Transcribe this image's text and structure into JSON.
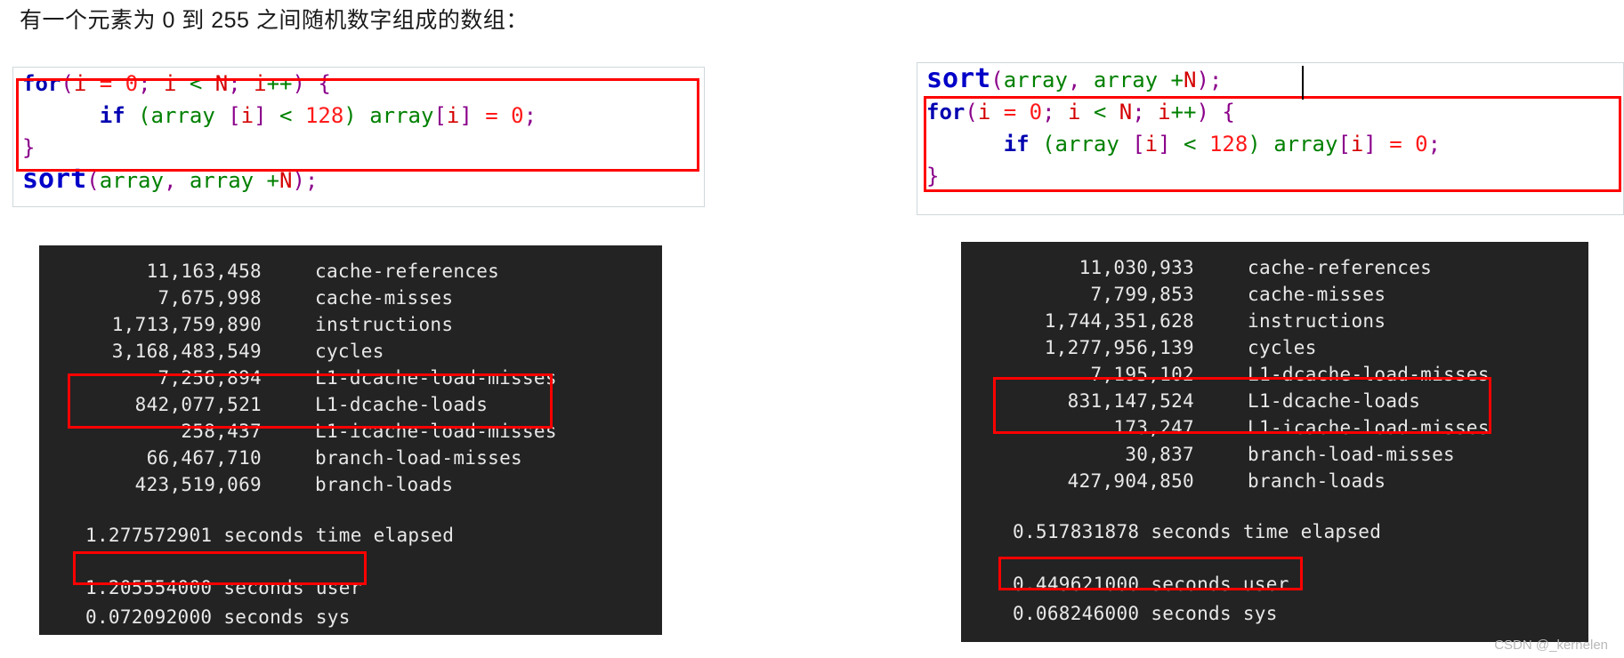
{
  "heading": "有一个元素为 0 到 255 之间随机数字组成的数组：",
  "code_left": {
    "lines": [
      {
        "tokens": [
          {
            "t": "for",
            "c": "kw"
          },
          {
            "t": "(",
            "c": "punct"
          },
          {
            "t": "i",
            "c": "ident"
          },
          {
            "t": " = ",
            "c": "num"
          },
          {
            "t": "0",
            "c": "num"
          },
          {
            "t": "; ",
            "c": "punct"
          },
          {
            "t": "i",
            "c": "ident"
          },
          {
            "t": " < ",
            "c": "op"
          },
          {
            "t": "N",
            "c": "ident"
          },
          {
            "t": "; ",
            "c": "punct"
          },
          {
            "t": "i",
            "c": "ident"
          },
          {
            "t": "++",
            "c": "op"
          },
          {
            "t": ")",
            "c": "punct"
          },
          {
            "t": " ",
            "c": "plain"
          },
          {
            "t": "{",
            "c": "brk"
          }
        ]
      },
      {
        "tokens": [
          {
            "t": "      ",
            "c": "plain"
          },
          {
            "t": "if",
            "c": "kw-if"
          },
          {
            "t": " ",
            "c": "plain"
          },
          {
            "t": "(",
            "c": "op"
          },
          {
            "t": "array",
            "c": "green"
          },
          {
            "t": " ",
            "c": "plain"
          },
          {
            "t": "[",
            "c": "brk"
          },
          {
            "t": "i",
            "c": "ident"
          },
          {
            "t": "]",
            "c": "brk"
          },
          {
            "t": " < ",
            "c": "op"
          },
          {
            "t": "128",
            "c": "num"
          },
          {
            "t": ")",
            "c": "op"
          },
          {
            "t": " ",
            "c": "plain"
          },
          {
            "t": "array",
            "c": "green"
          },
          {
            "t": "[",
            "c": "brk"
          },
          {
            "t": "i",
            "c": "ident"
          },
          {
            "t": "]",
            "c": "brk"
          },
          {
            "t": " = ",
            "c": "num"
          },
          {
            "t": "0",
            "c": "num"
          },
          {
            "t": ";",
            "c": "punct"
          }
        ]
      },
      {
        "tokens": [
          {
            "t": "}",
            "c": "brk"
          }
        ]
      },
      {
        "tokens": [
          {
            "t": "sort",
            "c": "fn-sort"
          },
          {
            "t": "(",
            "c": "punct"
          },
          {
            "t": "array",
            "c": "green"
          },
          {
            "t": ", ",
            "c": "punct"
          },
          {
            "t": "array",
            "c": "green"
          },
          {
            "t": " +",
            "c": "op"
          },
          {
            "t": "N",
            "c": "ident"
          },
          {
            "t": ")",
            "c": "punct"
          },
          {
            "t": ";",
            "c": "punct"
          }
        ]
      }
    ],
    "plain_text": "for(i = 0; i < N; i++) {\n      if (array [i] < 128) array[i] = 0;\n}\nsort(array, array +N);"
  },
  "code_right": {
    "lines": [
      {
        "tokens": [
          {
            "t": "sort",
            "c": "fn-sort"
          },
          {
            "t": "(",
            "c": "punct"
          },
          {
            "t": "array",
            "c": "green"
          },
          {
            "t": ", ",
            "c": "punct"
          },
          {
            "t": "array",
            "c": "green"
          },
          {
            "t": " +",
            "c": "op"
          },
          {
            "t": "N",
            "c": "ident"
          },
          {
            "t": ")",
            "c": "punct"
          },
          {
            "t": ";",
            "c": "punct"
          }
        ]
      },
      {
        "tokens": [
          {
            "t": "for",
            "c": "kw"
          },
          {
            "t": "(",
            "c": "punct"
          },
          {
            "t": "i",
            "c": "ident"
          },
          {
            "t": " = ",
            "c": "num"
          },
          {
            "t": "0",
            "c": "num"
          },
          {
            "t": "; ",
            "c": "punct"
          },
          {
            "t": "i",
            "c": "ident"
          },
          {
            "t": " < ",
            "c": "op"
          },
          {
            "t": "N",
            "c": "ident"
          },
          {
            "t": "; ",
            "c": "punct"
          },
          {
            "t": "i",
            "c": "ident"
          },
          {
            "t": "++",
            "c": "op"
          },
          {
            "t": ")",
            "c": "punct"
          },
          {
            "t": " ",
            "c": "plain"
          },
          {
            "t": "{",
            "c": "brk"
          }
        ]
      },
      {
        "tokens": [
          {
            "t": "      ",
            "c": "plain"
          },
          {
            "t": "if",
            "c": "kw-if"
          },
          {
            "t": " ",
            "c": "plain"
          },
          {
            "t": "(",
            "c": "op"
          },
          {
            "t": "array",
            "c": "green"
          },
          {
            "t": " ",
            "c": "plain"
          },
          {
            "t": "[",
            "c": "brk"
          },
          {
            "t": "i",
            "c": "ident"
          },
          {
            "t": "]",
            "c": "brk"
          },
          {
            "t": " < ",
            "c": "op"
          },
          {
            "t": "128",
            "c": "num"
          },
          {
            "t": ")",
            "c": "op"
          },
          {
            "t": " ",
            "c": "plain"
          },
          {
            "t": "array",
            "c": "green"
          },
          {
            "t": "[",
            "c": "brk"
          },
          {
            "t": "i",
            "c": "ident"
          },
          {
            "t": "]",
            "c": "brk"
          },
          {
            "t": " = ",
            "c": "num"
          },
          {
            "t": "0",
            "c": "num"
          },
          {
            "t": ";",
            "c": "punct"
          }
        ]
      },
      {
        "tokens": [
          {
            "t": "}",
            "c": "brk"
          }
        ]
      }
    ],
    "plain_text": "sort(array, array +N);\nfor(i = 0; i < N; i++) {\n      if (array [i] < 128) array[i] = 0;\n}"
  },
  "terminal_left": {
    "stats": [
      {
        "value": "11,163,458",
        "label": "cache-references"
      },
      {
        "value": "7,675,998",
        "label": "cache-misses"
      },
      {
        "value": "1,713,759,890",
        "label": "instructions"
      },
      {
        "value": "3,168,483,549",
        "label": "cycles"
      },
      {
        "value": "7,256,894",
        "label": "L1-dcache-load-misses"
      },
      {
        "value": "842,077,521",
        "label": "L1-dcache-loads"
      },
      {
        "value": "258,437",
        "label": "L1-icache-load-misses"
      },
      {
        "value": "66,467,710",
        "label": "branch-load-misses"
      },
      {
        "value": "423,519,069",
        "label": "branch-loads"
      }
    ],
    "elapsed": "1.277572901 seconds time elapsed",
    "user": "1.205554000 seconds user",
    "sys": "0.072092000 seconds sys"
  },
  "terminal_right": {
    "stats": [
      {
        "value": "11,030,933",
        "label": "cache-references"
      },
      {
        "value": "7,799,853",
        "label": "cache-misses"
      },
      {
        "value": "1,744,351,628",
        "label": "instructions"
      },
      {
        "value": "1,277,956,139",
        "label": "cycles"
      },
      {
        "value": "7,195,102",
        "label": "L1-dcache-load-misses"
      },
      {
        "value": "831,147,524",
        "label": "L1-dcache-loads"
      },
      {
        "value": "173,247",
        "label": "L1-icache-load-misses"
      },
      {
        "value": "30,837",
        "label": "branch-load-misses"
      },
      {
        "value": "427,904,850",
        "label": "branch-loads"
      }
    ],
    "elapsed": "0.517831878 seconds time elapsed",
    "user": "0.449621000 seconds user",
    "sys": "0.068246000 seconds sys"
  },
  "watermark": "CSDN @_kernelen",
  "colors": {
    "highlight": "#ff0000",
    "terminal_bg": "#232323",
    "terminal_fg": "#e8e8e8",
    "keyword": "#0000b0",
    "string_green": "#008000",
    "number_red": "#ff1a1a",
    "bracket_purple": "#8b008b"
  }
}
